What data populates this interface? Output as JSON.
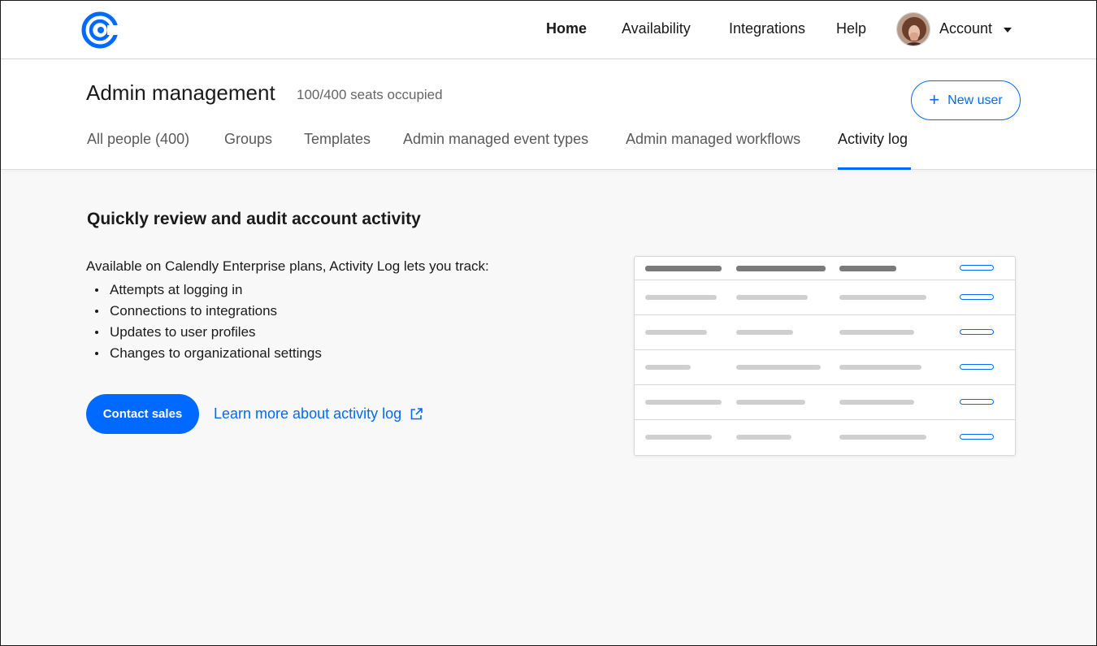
{
  "nav": {
    "links": [
      {
        "label": "Home",
        "active": true
      },
      {
        "label": "Availability",
        "active": false
      },
      {
        "label": "Integrations",
        "active": false
      },
      {
        "label": "Help",
        "active": false
      }
    ],
    "account_label": "Account"
  },
  "header": {
    "title": "Admin management",
    "seats": "100/400 seats occupied",
    "new_user_label": "New user",
    "tabs": [
      {
        "label": "All people (400)",
        "active": false
      },
      {
        "label": "Groups",
        "active": false
      },
      {
        "label": "Templates",
        "active": false
      },
      {
        "label": "Admin managed event types",
        "active": false
      },
      {
        "label": "Admin managed workflows",
        "active": false
      },
      {
        "label": "Activity log",
        "active": true
      }
    ]
  },
  "main": {
    "title": "Quickly review and audit account activity",
    "intro": "Available on Calendly Enterprise plans, Activity Log lets you track:",
    "bullets": [
      "Attempts at logging in",
      "Connections to integrations",
      "Updates to user profiles",
      "Changes to organizational settings"
    ],
    "contact_label": "Contact sales",
    "learn_more_label": "Learn more about activity log"
  },
  "icons": {
    "logo": "calendly-logo-icon",
    "external_link": "external-link-icon",
    "plus": "plus-icon",
    "caret": "chevron-down-icon"
  },
  "colors": {
    "accent": "#0069ff",
    "text": "#1a1a1a",
    "muted": "#5a5a5a",
    "background": "#f8f8f8"
  }
}
